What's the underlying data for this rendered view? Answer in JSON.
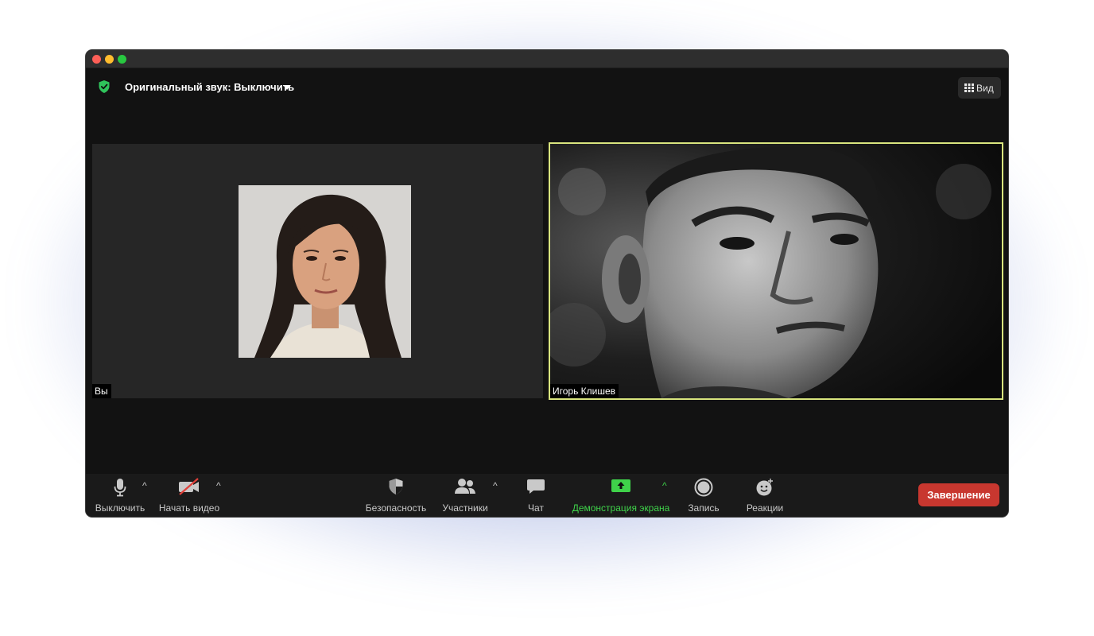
{
  "topbar": {
    "original_sound_label": "Оригинальный звук: Выключить",
    "view_label": "Вид"
  },
  "participants": [
    {
      "name": "Вы"
    },
    {
      "name": "Игорь Клишев"
    }
  ],
  "toolbar": {
    "mute_label": "Выключить",
    "start_video_label": "Начать видео",
    "security_label": "Безопасность",
    "participants_label": "Участники",
    "chat_label": "Чат",
    "share_screen_label": "Демонстрация экрана",
    "record_label": "Запись",
    "reactions_label": "Реакции",
    "end_label": "Завершение"
  },
  "colors": {
    "accent_green": "#3fd24a",
    "end_red": "#c8372f",
    "active_speaker_border": "#d9e57e"
  }
}
